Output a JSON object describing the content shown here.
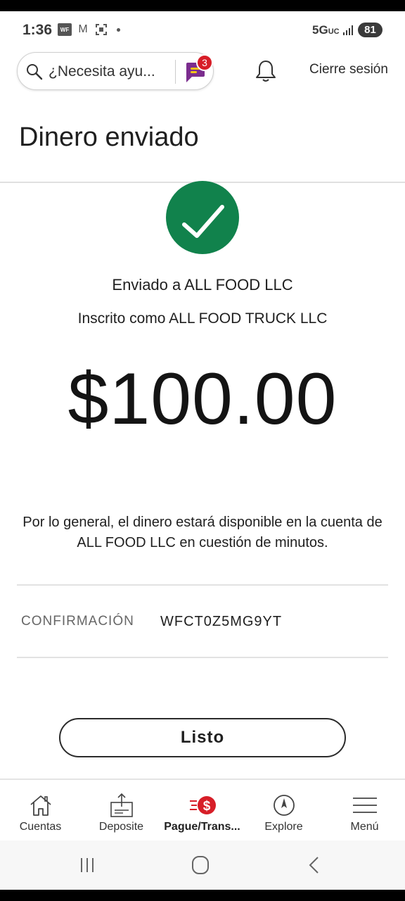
{
  "status_bar": {
    "time": "1:36",
    "icons": [
      "wf-app-icon",
      "gmail-icon",
      "screenshot-icon",
      "dot"
    ],
    "network": "5G",
    "network_suffix": "UC",
    "battery": "81"
  },
  "header": {
    "search_placeholder": "¿Necesita ayu...",
    "chat_badge_count": "3",
    "logout_label": "Cierre sesión"
  },
  "page": {
    "title": "Dinero enviado"
  },
  "confirmation": {
    "sent_to": "Enviado a ALL FOOD LLC",
    "enrolled_as": "Inscrito como ALL FOOD TRUCK LLC",
    "amount": "$100.00",
    "availability_note": "Por lo general, el dinero estará disponible en la cuenta de ALL FOOD LLC en cuestión de minutos.",
    "confirmation_label": "CONFIRMACIÓN",
    "confirmation_number": "WFCT0Z5MG9YT",
    "done_label": "Listo"
  },
  "bottom_nav": {
    "items": [
      {
        "label": "Cuentas",
        "icon": "home-icon"
      },
      {
        "label": "Deposite",
        "icon": "deposit-icon"
      },
      {
        "label": "Pague/Trans...",
        "icon": "pay-transfer-icon",
        "active": true
      },
      {
        "label": "Explore",
        "icon": "compass-icon"
      },
      {
        "label": "Menú",
        "icon": "hamburger-icon"
      }
    ]
  },
  "colors": {
    "success_green": "#11824c",
    "brand_red": "#d71e28",
    "chat_purple": "#7b2d8e"
  }
}
